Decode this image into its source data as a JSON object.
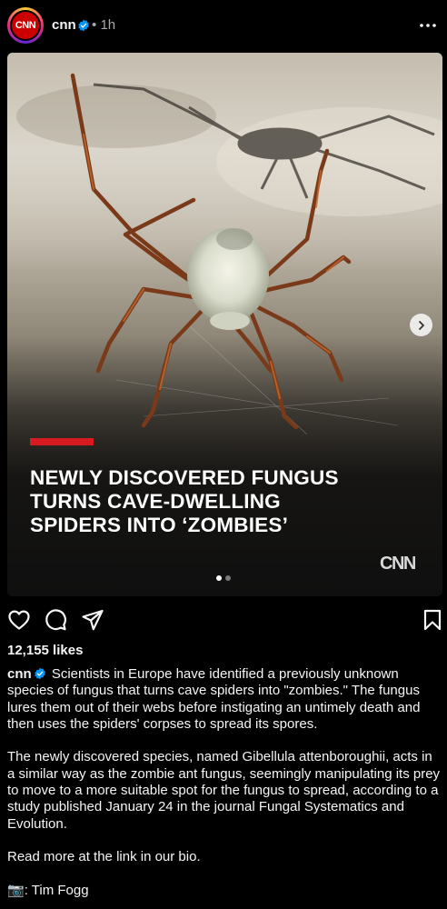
{
  "header": {
    "avatar_text": "CNN",
    "username": "cnn",
    "separator": "•",
    "time": "1h"
  },
  "media": {
    "headline_lines": [
      "NEWLY DISCOVERED FUNGUS",
      "TURNS CAVE-DWELLING",
      "SPIDERS INTO ‘ZOMBIES’"
    ],
    "logo_text": "CNN",
    "slide_count": 2,
    "active_slide": 1
  },
  "actions": {
    "icons": [
      "heart-icon",
      "comment-icon",
      "share-icon",
      "bookmark-icon"
    ]
  },
  "likes": "12,155 likes",
  "caption": {
    "username": "cnn",
    "paragraphs": [
      "Scientists in Europe have identified a previously unknown species of fungus that turns cave spiders into \"zombies.\" The fungus lures them out of their webs before instigating an untimely death and then uses the spiders' corpses to spread its spores.",
      "The newly discovered species, named Gibellula attenboroughii, acts in a similar way as the zombie ant fungus, seemingly manipulating its prey to move to a more suitable spot for the fungus to spread, according to a study published January 24 in the journal Fungal Systematics and Evolution.",
      "Read more at the link in our bio."
    ],
    "credit_icon": "📷",
    "credit": ": Tim Fogg"
  },
  "colors": {
    "background": "#000000",
    "text": "#f5f5f5",
    "muted": "#a8a8a8",
    "verified": "#0095f6",
    "cnn_red": "#cc0000",
    "headline_bar": "#d71920"
  }
}
